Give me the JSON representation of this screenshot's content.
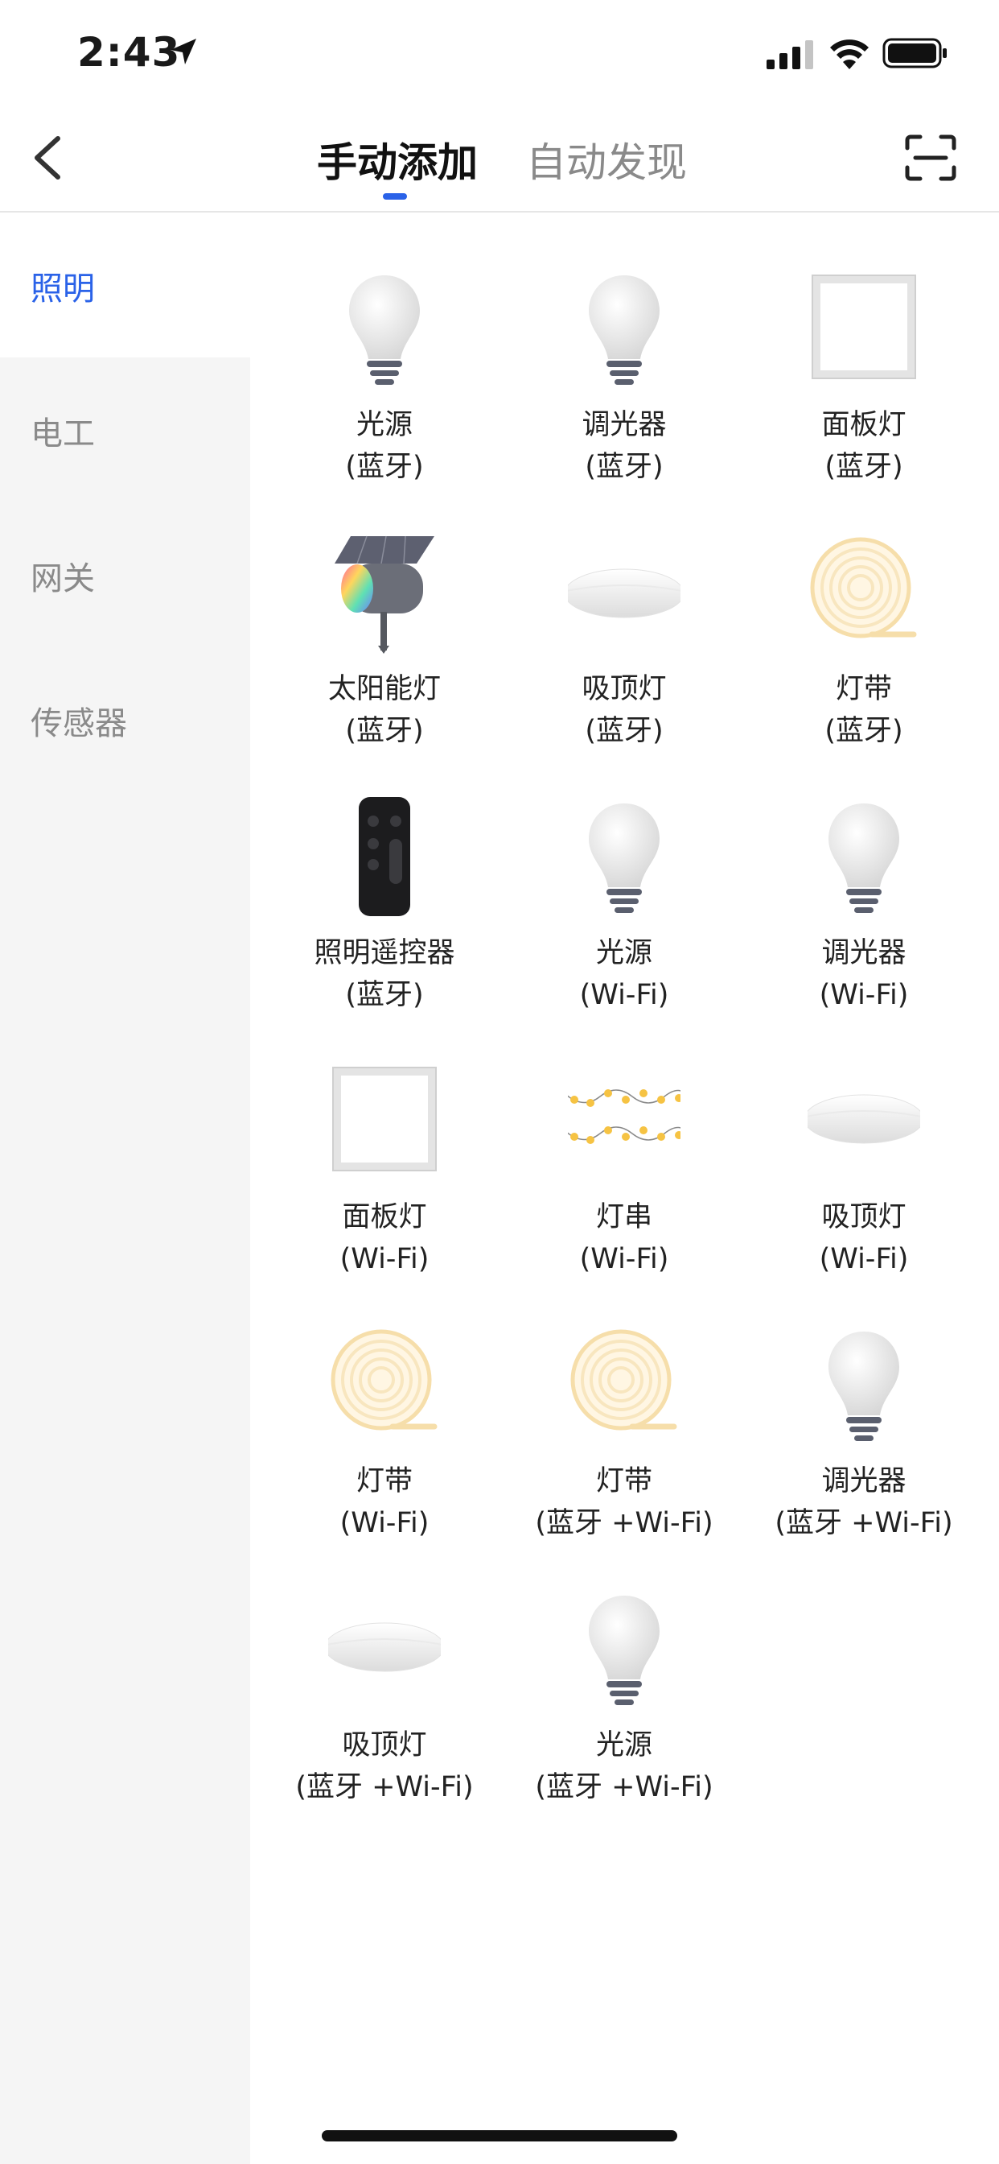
{
  "status_bar": {
    "time": "2:43"
  },
  "nav": {
    "tabs": [
      {
        "label": "手动添加",
        "active": true
      },
      {
        "label": "自动发现",
        "active": false
      }
    ]
  },
  "sidebar": {
    "items": [
      {
        "label": "照明",
        "active": true
      },
      {
        "label": "电工",
        "active": false
      },
      {
        "label": "网关",
        "active": false
      },
      {
        "label": "传感器",
        "active": false
      }
    ]
  },
  "devices": [
    {
      "name": "光源",
      "protocol": "(蓝牙)",
      "icon": "bulb-icon"
    },
    {
      "name": "调光器",
      "protocol": "(蓝牙)",
      "icon": "bulb-icon"
    },
    {
      "name": "面板灯",
      "protocol": "(蓝牙)",
      "icon": "panel-light-icon"
    },
    {
      "name": "太阳能灯",
      "protocol": "(蓝牙)",
      "icon": "solar-light-icon"
    },
    {
      "name": "吸顶灯",
      "protocol": "(蓝牙)",
      "icon": "ceiling-light-icon"
    },
    {
      "name": "灯带",
      "protocol": "(蓝牙)",
      "icon": "light-strip-icon"
    },
    {
      "name": "照明遥控器",
      "protocol": "(蓝牙)",
      "icon": "remote-icon"
    },
    {
      "name": "光源",
      "protocol": "(Wi-Fi)",
      "icon": "bulb-icon"
    },
    {
      "name": "调光器",
      "protocol": "(Wi-Fi)",
      "icon": "bulb-icon"
    },
    {
      "name": "面板灯",
      "protocol": "(Wi-Fi)",
      "icon": "panel-light-icon"
    },
    {
      "name": "灯串",
      "protocol": "(Wi-Fi)",
      "icon": "string-lights-icon"
    },
    {
      "name": "吸顶灯",
      "protocol": "(Wi-Fi)",
      "icon": "ceiling-light-icon"
    },
    {
      "name": "灯带",
      "protocol": "(Wi-Fi)",
      "icon": "light-strip-icon"
    },
    {
      "name": "灯带",
      "protocol": "(蓝牙 +Wi-Fi)",
      "icon": "light-strip-icon"
    },
    {
      "name": "调光器",
      "protocol": "(蓝牙 +Wi-Fi)",
      "icon": "bulb-icon"
    },
    {
      "name": "吸顶灯",
      "protocol": "(蓝牙 +Wi-Fi)",
      "icon": "ceiling-light-icon"
    },
    {
      "name": "光源",
      "protocol": "(蓝牙 +Wi-Fi)",
      "icon": "bulb-icon"
    }
  ],
  "colors": {
    "accent": "#2a62e8",
    "sidebar_bg": "#f5f5f5",
    "inactive_text": "#8a8a8a"
  }
}
